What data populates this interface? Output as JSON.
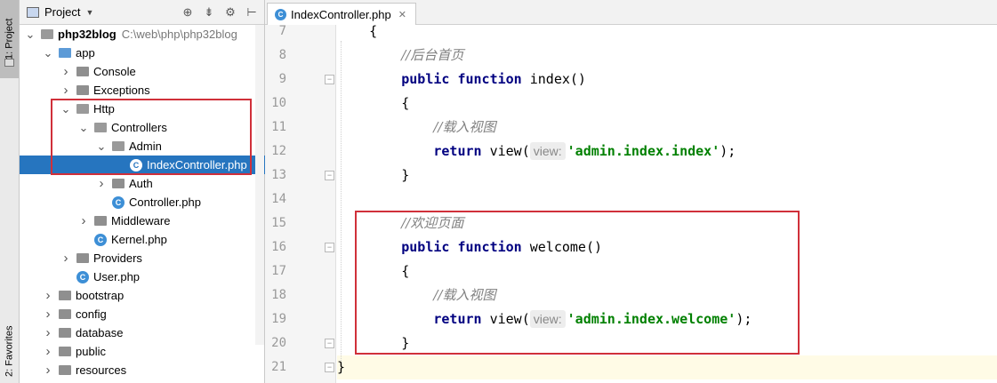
{
  "toolwindow": {
    "project_tab": "1: Project",
    "favorites_tab": "2: Favorites"
  },
  "project_panel": {
    "title": "Project",
    "tree": [
      {
        "label": "php32blog",
        "path": "C:\\web\\php\\php32blog",
        "type": "folder",
        "expanded": true,
        "depth": 0,
        "bold": true
      },
      {
        "label": "app",
        "type": "folder",
        "expanded": true,
        "depth": 1,
        "color": "blue"
      },
      {
        "label": "Console",
        "type": "folder",
        "expanded": false,
        "depth": 2
      },
      {
        "label": "Exceptions",
        "type": "folder",
        "expanded": false,
        "depth": 2
      },
      {
        "label": "Http",
        "type": "folder",
        "expanded": true,
        "depth": 2
      },
      {
        "label": "Controllers",
        "type": "folder",
        "expanded": true,
        "depth": 3
      },
      {
        "label": "Admin",
        "type": "folder",
        "expanded": true,
        "depth": 4
      },
      {
        "label": "IndexController.php",
        "type": "file",
        "depth": 5,
        "selected": true
      },
      {
        "label": "Auth",
        "type": "folder",
        "expanded": false,
        "depth": 4
      },
      {
        "label": "Controller.php",
        "type": "file",
        "depth": 4
      },
      {
        "label": "Middleware",
        "type": "folder",
        "expanded": false,
        "depth": 3
      },
      {
        "label": "Kernel.php",
        "type": "file",
        "depth": 3
      },
      {
        "label": "Providers",
        "type": "folder",
        "expanded": false,
        "depth": 2
      },
      {
        "label": "User.php",
        "type": "file",
        "depth": 2
      },
      {
        "label": "bootstrap",
        "type": "folder",
        "expanded": false,
        "depth": 1
      },
      {
        "label": "config",
        "type": "folder",
        "expanded": false,
        "depth": 1
      },
      {
        "label": "database",
        "type": "folder",
        "expanded": false,
        "depth": 1
      },
      {
        "label": "public",
        "type": "folder",
        "expanded": false,
        "depth": 1
      },
      {
        "label": "resources",
        "type": "folder",
        "expanded": false,
        "depth": 1
      }
    ]
  },
  "editor": {
    "tab_label": "IndexController.php",
    "lines": [
      {
        "n": "7",
        "segs": [
          {
            "t": "    {",
            "c": ""
          }
        ]
      },
      {
        "n": "8",
        "segs": [
          {
            "t": "        ",
            "c": ""
          },
          {
            "t": "//后台首页",
            "c": "cm"
          }
        ]
      },
      {
        "n": "9",
        "segs": [
          {
            "t": "        ",
            "c": ""
          },
          {
            "t": "public function",
            "c": "kw"
          },
          {
            "t": " index()",
            "c": ""
          }
        ]
      },
      {
        "n": "10",
        "segs": [
          {
            "t": "        {",
            "c": ""
          }
        ]
      },
      {
        "n": "11",
        "segs": [
          {
            "t": "            ",
            "c": ""
          },
          {
            "t": "//载入视图",
            "c": "cm"
          }
        ]
      },
      {
        "n": "12",
        "segs": [
          {
            "t": "            ",
            "c": ""
          },
          {
            "t": "return",
            "c": "kw"
          },
          {
            "t": " view(",
            "c": ""
          },
          {
            "t": "view:",
            "c": "hint"
          },
          {
            "t": "'admin.index.index'",
            "c": "str"
          },
          {
            "t": ");",
            "c": ""
          }
        ]
      },
      {
        "n": "13",
        "segs": [
          {
            "t": "        }",
            "c": ""
          }
        ]
      },
      {
        "n": "14",
        "segs": [
          {
            "t": "",
            "c": ""
          }
        ]
      },
      {
        "n": "15",
        "segs": [
          {
            "t": "        ",
            "c": ""
          },
          {
            "t": "//欢迎页面",
            "c": "cm"
          }
        ]
      },
      {
        "n": "16",
        "segs": [
          {
            "t": "        ",
            "c": ""
          },
          {
            "t": "public function",
            "c": "kw"
          },
          {
            "t": " welcome()",
            "c": ""
          }
        ]
      },
      {
        "n": "17",
        "segs": [
          {
            "t": "        {",
            "c": ""
          }
        ]
      },
      {
        "n": "18",
        "segs": [
          {
            "t": "            ",
            "c": ""
          },
          {
            "t": "//载入视图",
            "c": "cm"
          }
        ]
      },
      {
        "n": "19",
        "segs": [
          {
            "t": "            ",
            "c": ""
          },
          {
            "t": "return",
            "c": "kw"
          },
          {
            "t": " view(",
            "c": ""
          },
          {
            "t": "view:",
            "c": "hint"
          },
          {
            "t": "'admin.index.welcome'",
            "c": "str"
          },
          {
            "t": ");",
            "c": ""
          }
        ]
      },
      {
        "n": "20",
        "segs": [
          {
            "t": "        }",
            "c": ""
          }
        ]
      },
      {
        "n": "21",
        "segs": [
          {
            "t": "}",
            "c": ""
          }
        ]
      }
    ]
  }
}
